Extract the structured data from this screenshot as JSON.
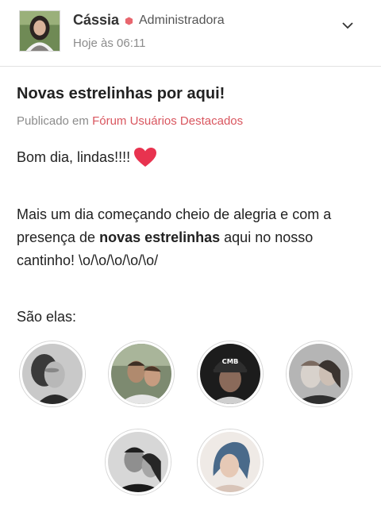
{
  "post": {
    "author": "Cássia",
    "role": "Administradora",
    "time": "Hoje às 06:11",
    "title": "Novas estrelinhas por aqui!",
    "published_prefix": "Publicado em",
    "forum": "Fórum Usuários Destacados",
    "greeting": "Bom dia, lindas!!!!",
    "para_part1": "Mais um dia começando cheio de alegria e com a presença de ",
    "para_bold": "novas estrelinhas",
    "para_part2": " aqui no nosso cantinho! \\o/\\o/\\o/\\o/\\o/",
    "sao_elas": "São elas:",
    "photo_cap_text": "CMB"
  },
  "icons": {
    "role": "hexagon-badge-icon",
    "menu": "chevron-down-icon",
    "greeting": "heart-icon"
  },
  "colors": {
    "link": "#d9565f",
    "role_badge": "#e8666e",
    "heart": "#e8334f",
    "divider": "#e2e2e2"
  }
}
